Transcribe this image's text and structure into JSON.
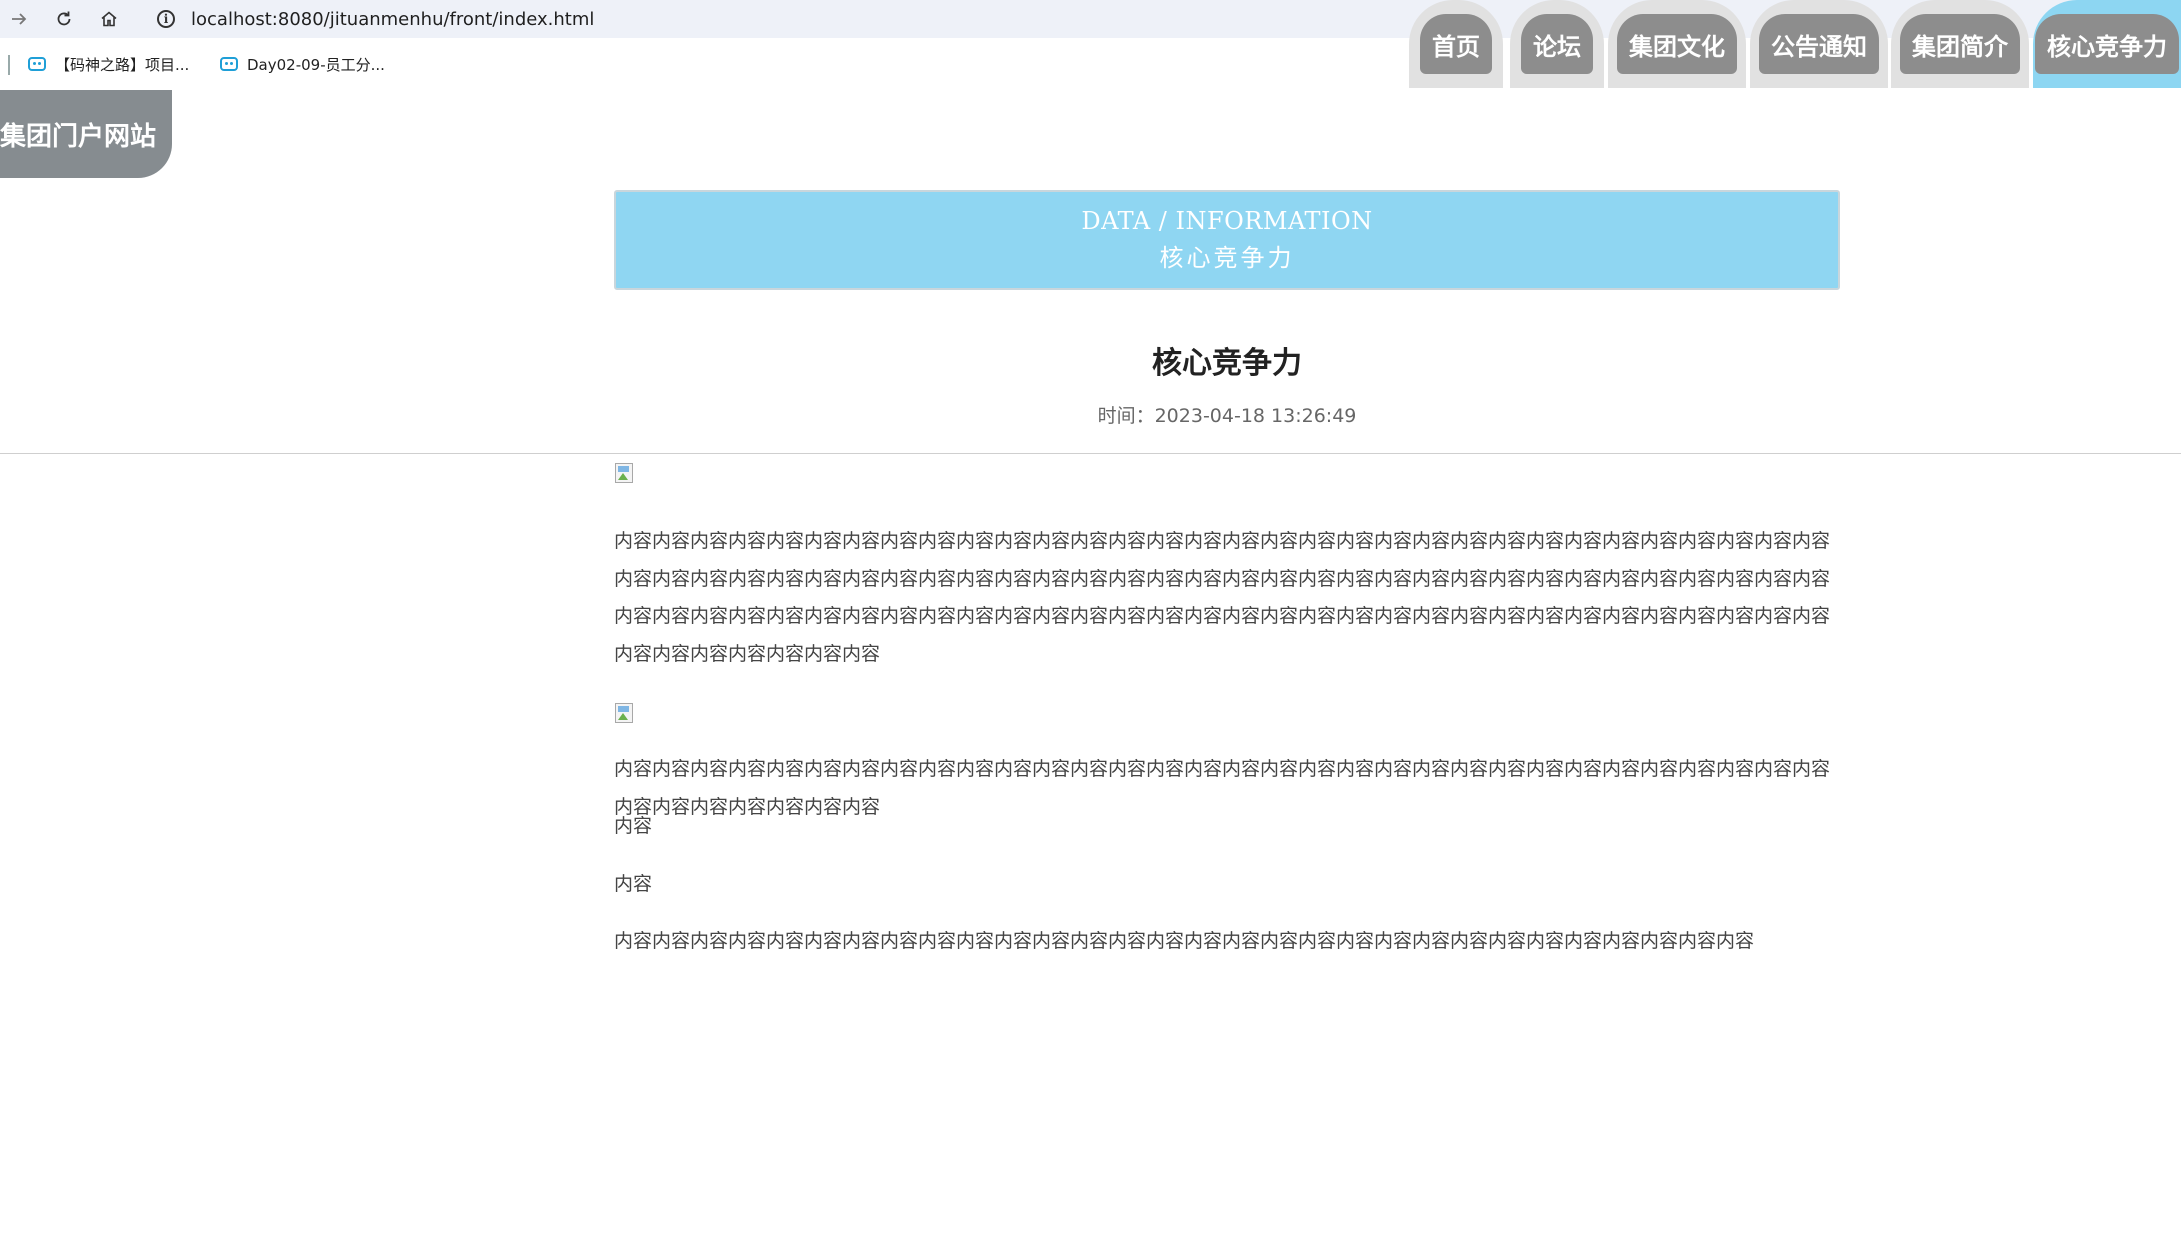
{
  "browser": {
    "url": "localhost:8080/jituanmenhu/front/index.html",
    "bookmarks": [
      {
        "label": "【码神之路】项目..."
      },
      {
        "label": "Day02-09-员工分..."
      }
    ]
  },
  "site": {
    "logo": "集团门户网站",
    "nav": [
      {
        "label": "首页",
        "active": false
      },
      {
        "label": "论坛",
        "active": false
      },
      {
        "label": "集团文化",
        "active": false
      },
      {
        "label": "公告通知",
        "active": false
      },
      {
        "label": "集团简介",
        "active": false
      },
      {
        "label": "核心竞争力",
        "active": true
      }
    ],
    "colors": {
      "accent": "#8fd6f2",
      "tab_pill": "#8d8d8d",
      "tab_bg": "#e1e1e1",
      "logo_bg": "#868c90"
    }
  },
  "banner": {
    "en": "DATA / INFORMATION",
    "cn": "核心竞争力"
  },
  "article": {
    "title": "核心竞争力",
    "time": "时间：2023-04-18 13:26:49",
    "paragraphs": [
      "内容内容内容内容内容内容内容内容内容内容内容内容内容内容内容内容内容内容内容内容内容内容内容内容内容内容内容内容内容内容内容内容内容内容内容内容内容内容内容内容内容内容内容内容内容内容内容内容内容内容内容内容内容内容内容内容内容内容内容内容内容内容内容内容内容内容内容内容内容内容内容内容内容内容内容内容内容内容内容内容内容内容内容内容内容内容内容内容内容内容内容内容内容内容内容内容内容内容内容内容内容内容内容",
      "内容内容内容内容内容内容内容内容内容内容内容内容内容内容内容内容内容内容内容内容内容内容内容内容内容内容内容内容内容内容内容内容内容内容内容内容内容内容内容",
      "内容",
      "内容",
      "内容内容内容内容内容内容内容内容内容内容内容内容内容内容内容内容内容内容内容内容内容内容内容内容内容内容内容内容内容内容"
    ]
  }
}
